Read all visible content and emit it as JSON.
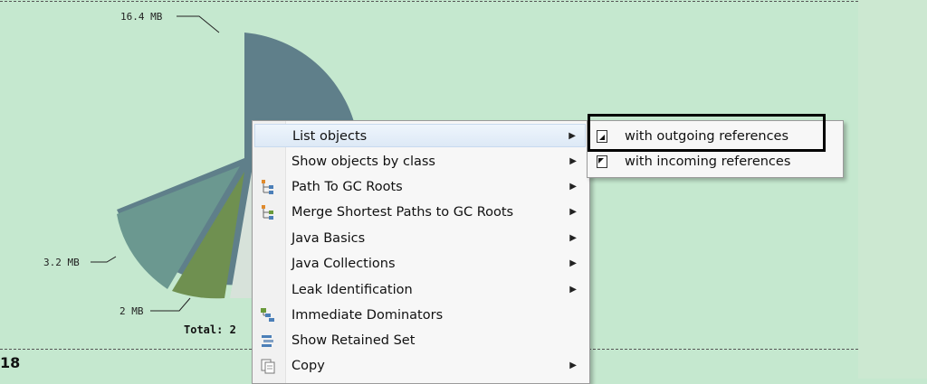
{
  "chart_data": {
    "type": "pie",
    "slices": [
      {
        "label": "16.4 MB",
        "value": 16.4,
        "color": "#5f7f8a"
      },
      {
        "label": "3.2 MB",
        "value": 3.2,
        "color": "#6b9890"
      },
      {
        "label": "2 MB",
        "value": 2,
        "color": "#6f9050"
      }
    ],
    "total_label": "Total: 2"
  },
  "left_fragment": "18",
  "context_menu": {
    "items": [
      {
        "label": "List objects",
        "has_submenu": true,
        "icon": ""
      },
      {
        "label": "Show objects by class",
        "has_submenu": true,
        "icon": ""
      },
      {
        "label": "Path To GC Roots",
        "has_submenu": true,
        "icon": "path-icon"
      },
      {
        "label": "Merge Shortest Paths to GC Roots",
        "has_submenu": true,
        "icon": "merge-icon"
      },
      {
        "label": "Java Basics",
        "has_submenu": true,
        "icon": ""
      },
      {
        "label": "Java Collections",
        "has_submenu": true,
        "icon": ""
      },
      {
        "label": "Leak Identification",
        "has_submenu": true,
        "icon": ""
      },
      {
        "label": "Immediate Dominators",
        "has_submenu": false,
        "icon": "dominators-icon"
      },
      {
        "label": "Show Retained Set",
        "has_submenu": false,
        "icon": "retained-set-icon"
      },
      {
        "label": "Copy",
        "has_submenu": true,
        "icon": "copy-icon"
      }
    ]
  },
  "submenu": {
    "items": [
      {
        "label": "with outgoing references",
        "icon": "outgoing-references-icon"
      },
      {
        "label": "with incoming references",
        "icon": "incoming-references-icon"
      }
    ]
  },
  "arrow_glyph": "▶"
}
